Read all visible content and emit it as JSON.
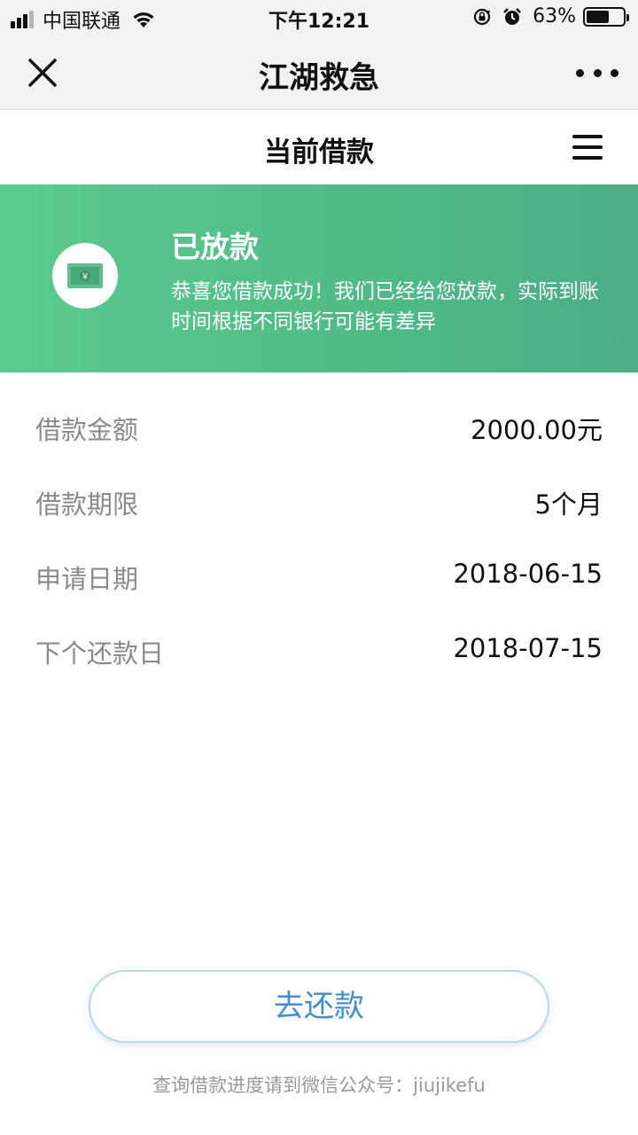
{
  "status_bar": {
    "carrier": "中国联通",
    "time": "下午12:21",
    "battery_percent": "63%",
    "battery_level": 0.63
  },
  "titlebar": {
    "title": "江湖救急",
    "close_icon": "close-icon",
    "more_icon": "more-icon"
  },
  "page": {
    "title": "当前借款",
    "menu_icon": "menu-icon"
  },
  "banner": {
    "title": "已放款",
    "description": "恭喜您借款成功！我们已经给您放款，实际到账时间根据不同银行可能有差异",
    "icon": "money-icon",
    "colors": {
      "start": "#5ccb8e",
      "end": "#4bae86"
    }
  },
  "loan": {
    "rows": [
      {
        "label": "借款金额",
        "value": "2000.00元"
      },
      {
        "label": "借款期限",
        "value": "5个月"
      },
      {
        "label": "申请日期",
        "value": "2018-06-15"
      },
      {
        "label": "下个还款日",
        "value": "2018-07-15"
      }
    ]
  },
  "actions": {
    "repay_label": "去还款"
  },
  "footer": {
    "note": "查询借款进度请到微信公众号：jiujikefu"
  }
}
